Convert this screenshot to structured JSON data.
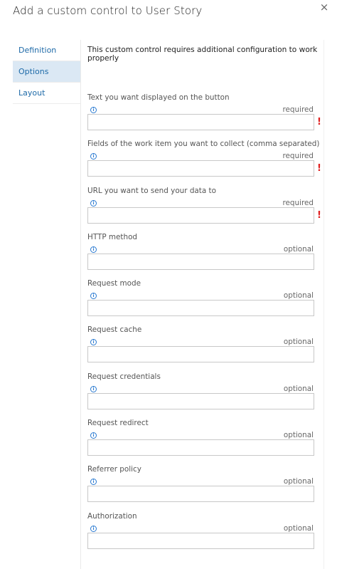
{
  "dialog": {
    "title": "Add a custom control to User Story",
    "close_glyph": "×"
  },
  "nav": {
    "items": [
      {
        "label": "Definition",
        "selected": false
      },
      {
        "label": "Options",
        "selected": true
      },
      {
        "label": "Layout",
        "selected": false
      }
    ]
  },
  "main": {
    "notice": "This custom control requires additional configuration to work properly",
    "fields": [
      {
        "label": "Text you want displayed on the button",
        "requirement": "required",
        "value": "",
        "error": "!"
      },
      {
        "label": "Fields of the work item you want to collect (comma separated)",
        "requirement": "required",
        "value": "",
        "error": "!"
      },
      {
        "label": "URL you want to send your data to",
        "requirement": "required",
        "value": "",
        "error": "!"
      },
      {
        "label": "HTTP method",
        "requirement": "optional",
        "value": ""
      },
      {
        "label": "Request mode",
        "requirement": "optional",
        "value": ""
      },
      {
        "label": "Request cache",
        "requirement": "optional",
        "value": ""
      },
      {
        "label": "Request credentials",
        "requirement": "optional",
        "value": ""
      },
      {
        "label": "Request redirect",
        "requirement": "optional",
        "value": ""
      },
      {
        "label": "Referrer policy",
        "requirement": "optional",
        "value": ""
      },
      {
        "label": "Authorization",
        "requirement": "optional",
        "value": ""
      }
    ]
  },
  "icons": {
    "info": "info-icon",
    "close": "close-icon",
    "error": "error-icon"
  },
  "colors": {
    "accent": "#1e6aa8",
    "selected_bg": "#dbe8f4",
    "error": "#e02020",
    "info": "#2a7ad1"
  }
}
